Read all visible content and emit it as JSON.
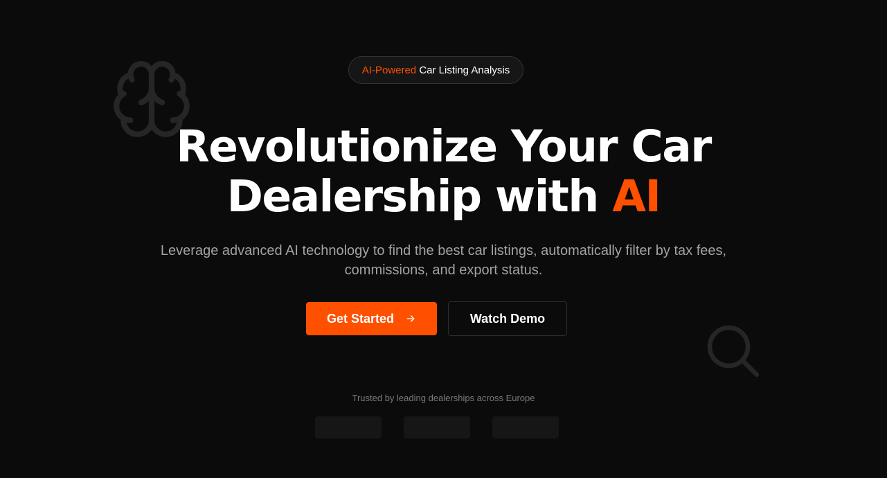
{
  "hero": {
    "badge": {
      "accent": "AI-Powered",
      "text": "Car Listing Analysis"
    },
    "headline": {
      "line1": "Revolutionize Your Car",
      "line2": "Dealership with",
      "accent": "AI"
    },
    "subtext": "Leverage advanced AI technology to find the best car listings, automatically filter by tax fees, commissions, and export status.",
    "buttons": {
      "primary_label": "Get Started",
      "primary_icon": "arrow-right-icon",
      "secondary_label": "Watch Demo"
    },
    "trusted_text": "Trusted by leading dealerships across Europe"
  },
  "decor": {
    "icons": [
      "brain-icon",
      "search-icon"
    ]
  },
  "colors": {
    "background": "#0b0b0b",
    "accent": "#ff5000",
    "muted_text": "#a3a3a3"
  }
}
